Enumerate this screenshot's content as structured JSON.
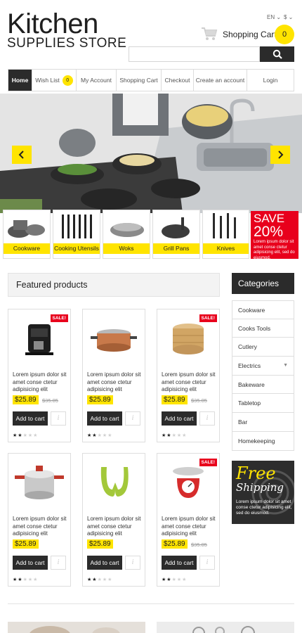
{
  "header": {
    "logo_main": "Kitchen",
    "logo_sub": "SUPPLIES STORE",
    "language": "EN ⌄",
    "currency": "$ ⌄",
    "cart_label": "Shopping Cart:",
    "cart_count": "0",
    "search_placeholder": ""
  },
  "nav": {
    "items": [
      {
        "label": "Home",
        "active": true
      },
      {
        "label": "Wish List",
        "badge": "0"
      },
      {
        "label": "My Account"
      },
      {
        "label": "Shopping Cart"
      },
      {
        "label": "Checkout"
      },
      {
        "label": "Create an account"
      },
      {
        "label": "Login"
      }
    ]
  },
  "slider": {
    "prev_icon": "chevron-left-icon",
    "next_icon": "chevron-right-icon"
  },
  "category_thumbs": [
    {
      "label": "Cookware"
    },
    {
      "label": "Cooking Utensils"
    },
    {
      "label": "Woks"
    },
    {
      "label": "Grill Pans"
    },
    {
      "label": "Knives"
    }
  ],
  "sale_banner": {
    "line1": "SAVE",
    "line2": "20%",
    "text": "Lorem ipsum dolor sit amet conse ctetur adipisicing elit, sed do eiusmod."
  },
  "featured": {
    "title": "Featured products",
    "add_label": "Add to cart",
    "sale_label": "SALE!",
    "products": [
      {
        "name": "Lorem ipsum dolor sit amet conse ctetur adipisicing elit",
        "price": "$25.89",
        "old_price": "$35.85",
        "sale": true,
        "rating": 2
      },
      {
        "name": "Lorem ipsum dolor sit amet conse ctetur adipisicing elit",
        "price": "$25.89",
        "old_price": "",
        "sale": false,
        "rating": 2
      },
      {
        "name": "Lorem ipsum dolor sit amet conse ctetur adipisicing elit",
        "price": "$25.89",
        "old_price": "$35.85",
        "sale": true,
        "rating": 2
      },
      {
        "name": "Lorem ipsum dolor sit amet conse ctetur adipisicing elit",
        "price": "$25.89",
        "old_price": "",
        "sale": false,
        "rating": 2
      },
      {
        "name": "Lorem ipsum dolor sit amet conse ctetur adipisicing elit",
        "price": "$25.89",
        "old_price": "",
        "sale": false,
        "rating": 2
      },
      {
        "name": "Lorem ipsum dolor sit amet conse ctetur adipisicing elit",
        "price": "$25.89",
        "old_price": "$35.85",
        "sale": true,
        "rating": 2
      }
    ]
  },
  "categories": {
    "title": "Categories",
    "items": [
      "Cookware",
      "Cooks Tools",
      "Cutlery",
      "Electrics",
      "Bakeware",
      "Tabletop",
      "Bar",
      "Homekeeping"
    ]
  },
  "free_shipping": {
    "line1": "Free",
    "line2": "Shipping",
    "text": "Lorem ipsum dolor sit amet conse ctetur adipisicing elit, sed do eiusmod."
  },
  "colors": {
    "accent": "#ffe400",
    "dark": "#2b2b2b",
    "sale": "#e8001c"
  }
}
